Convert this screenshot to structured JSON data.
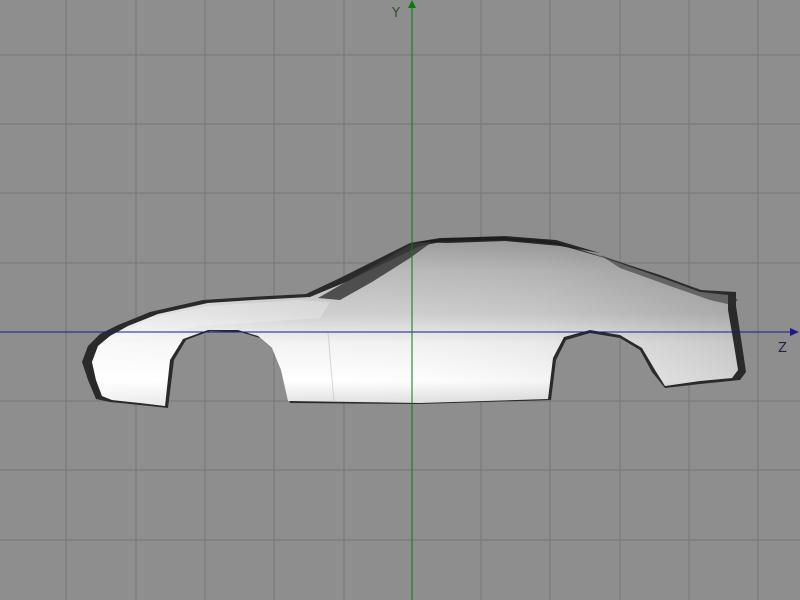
{
  "viewport": {
    "background_color": "#8e8e8e",
    "grid_color": "#777777",
    "y_axis": {
      "label": "Y",
      "color": "#0a7a0a"
    },
    "z_axis": {
      "label": "Z",
      "color": "#1a1a8c"
    }
  },
  "model": {
    "object": "car-body-shell",
    "shading": "smooth-gray"
  }
}
